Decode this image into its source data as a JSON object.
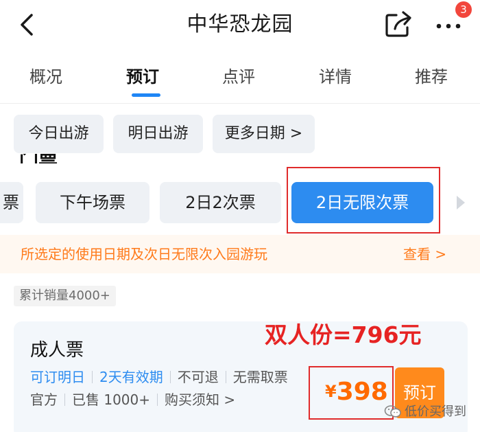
{
  "header": {
    "title": "中华恐龙园",
    "notification_count": "3",
    "icons": {
      "back": "chevron-left-icon",
      "share": "share-icon",
      "more": "more-dots-icon"
    }
  },
  "tabs": [
    {
      "label": "概况",
      "active": false
    },
    {
      "label": "预订",
      "active": true
    },
    {
      "label": "点评",
      "active": false
    },
    {
      "label": "详情",
      "active": false
    },
    {
      "label": "推荐",
      "active": false
    }
  ],
  "date_chips": [
    "今日出游",
    "明日出游",
    "更多日期 >"
  ],
  "section_title_partial": "门票",
  "ticket_types": [
    {
      "label": "票",
      "selected": false
    },
    {
      "label": "下午场票",
      "selected": false
    },
    {
      "label": "2日2次票",
      "selected": false
    },
    {
      "label": "2日无限次票",
      "selected": true
    }
  ],
  "info_banner": {
    "text": "所选定的使用日期及次日无限次入园游玩",
    "link": "查看 >"
  },
  "sales_tag": "累计销量4000+",
  "product": {
    "name": "成人票",
    "promo_text": "双人份=796元",
    "tags_blue": [
      "可订明日",
      "2天有效期"
    ],
    "tags_gray": [
      "不可退",
      "无需取票"
    ],
    "meta": [
      "官方",
      "已售 1000+",
      "购买须知 >"
    ],
    "currency": "¥",
    "price": "398",
    "book_label": "预订"
  },
  "watermark": "低价买得到",
  "colors": {
    "accent_blue": "#2d8cf0",
    "orange": "#ff7a1a",
    "price_orange": "#ff6a00",
    "annotation_red": "#e02b2b",
    "badge_red": "#f2463c"
  }
}
